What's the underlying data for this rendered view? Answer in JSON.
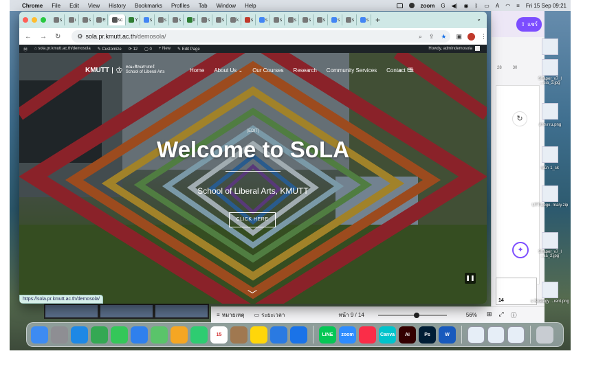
{
  "menubar": {
    "app_name": "Chrome",
    "items": [
      "File",
      "Edit",
      "View",
      "History",
      "Bookmarks",
      "Profiles",
      "Tab",
      "Window",
      "Help"
    ],
    "zoom_label": "zoom",
    "clock": "Fri 15 Sep  09:21"
  },
  "browser": {
    "tabs": [
      {
        "label": "s",
        "fav": "#777"
      },
      {
        "label": "ι",
        "fav": "#777"
      },
      {
        "label": "s",
        "fav": "#777"
      },
      {
        "label": "E",
        "fav": "#777"
      },
      {
        "label": "sc",
        "fav": "#555",
        "active": true
      },
      {
        "label": "Y",
        "fav": "#2e7d32"
      },
      {
        "label": "s",
        "fav": "#4285f4"
      },
      {
        "label": "s",
        "fav": "#777"
      },
      {
        "label": "s",
        "fav": "#777"
      },
      {
        "label": "Ⅱ",
        "fav": "#2e7d32"
      },
      {
        "label": "s",
        "fav": "#777"
      },
      {
        "label": "s",
        "fav": "#777"
      },
      {
        "label": "k",
        "fav": "#777"
      },
      {
        "label": "s",
        "fav": "#c0392b"
      },
      {
        "label": "s",
        "fav": "#4285f4"
      },
      {
        "label": "s",
        "fav": "#777"
      },
      {
        "label": "s",
        "fav": "#777"
      },
      {
        "label": "s",
        "fav": "#777"
      },
      {
        "label": "s",
        "fav": "#777"
      },
      {
        "label": "s",
        "fav": "#4285f4"
      },
      {
        "label": "s",
        "fav": "#777"
      },
      {
        "label": "s",
        "fav": "#4285f4"
      }
    ],
    "url_host": "sola.pr.kmutt.ac.th",
    "url_path": "/demosola/",
    "status_url": "https://sola.pr.kmutt.ac.th/demosola/"
  },
  "wp_admin": {
    "site": "sola.pr.kmutt.ac.th/demosola",
    "customize": "Customize",
    "updates": "12",
    "comments": "0",
    "new": "+ New",
    "edit_page": "Edit Page",
    "howdy": "Howdy, admindemosola"
  },
  "site": {
    "logo_mark": "KMUTT",
    "logo_thai": "คณะศิลปศาสตร์",
    "logo_en": "School of Liberal Arts",
    "nav": [
      "Home",
      "About Us",
      "Our Courses",
      "Research",
      "Community Services",
      "Contact Us"
    ],
    "edit_link": "[EDIT]",
    "hero_title": "Welcome to SoLA",
    "hero_subtitle": "School of Liberal Arts, KMUTT",
    "cta": "CLICK HERE"
  },
  "slides_window": {
    "share_label": "แชร์",
    "ruler": [
      "28",
      "30"
    ],
    "thumb_number": "14"
  },
  "docbar": {
    "notes": "หมายเหตุ",
    "timer": "ระยะเวลา",
    "page": "หน้า 9 / 14",
    "zoom_fraction": 0.56,
    "zoom": "56%"
  },
  "desktop_files": [
    "Shaper_v7_I ...sia_3.jpg",
    "สารงาน.png",
    "หน้า 1_sk",
    "UTT-Logo- mary.zip",
    "Shaper_v7_I ...ia_2.jpg",
    "s Strategy ...rent.png"
  ],
  "dock": [
    {
      "name": "finder",
      "color": "#3d8bf2",
      "label": ""
    },
    {
      "name": "launchpad",
      "color": "#8e8e93",
      "label": ""
    },
    {
      "name": "safari",
      "color": "#1e88e5",
      "label": ""
    },
    {
      "name": "chrome",
      "color": "#34a853",
      "label": ""
    },
    {
      "name": "messages",
      "color": "#34c759",
      "label": ""
    },
    {
      "name": "mail",
      "color": "#2f80ed",
      "label": ""
    },
    {
      "name": "maps",
      "color": "#5ac46a",
      "label": ""
    },
    {
      "name": "photos",
      "color": "#f5a623",
      "label": ""
    },
    {
      "name": "facetime",
      "color": "#2ecc71",
      "label": ""
    },
    {
      "name": "calendar",
      "color": "#ffffff",
      "label": "15"
    },
    {
      "name": "contacts",
      "color": "#a07850",
      "label": ""
    },
    {
      "name": "notes",
      "color": "#ffd60a",
      "label": ""
    },
    {
      "name": "freeform",
      "color": "#2a7ae2",
      "label": ""
    },
    {
      "name": "keynote",
      "color": "#1a73e8",
      "label": ""
    },
    {
      "name": "line",
      "color": "#06c755",
      "label": "LINE"
    },
    {
      "name": "zoom",
      "color": "#2d8cff",
      "label": "zoom"
    },
    {
      "name": "music",
      "color": "#fa2d48",
      "label": ""
    },
    {
      "name": "canva",
      "color": "#00c4cc",
      "label": "Canva"
    },
    {
      "name": "illustrator",
      "color": "#330000",
      "label": "Ai"
    },
    {
      "name": "photoshop",
      "color": "#001e36",
      "label": "Ps"
    },
    {
      "name": "word",
      "color": "#185abd",
      "label": "W"
    },
    {
      "name": "preview-1",
      "color": "#e6eef7",
      "label": ""
    },
    {
      "name": "preview-2",
      "color": "#e6eef7",
      "label": ""
    },
    {
      "name": "preview-3",
      "color": "#e6eef7",
      "label": ""
    },
    {
      "name": "trash",
      "color": "#c8ccd2",
      "label": ""
    }
  ]
}
